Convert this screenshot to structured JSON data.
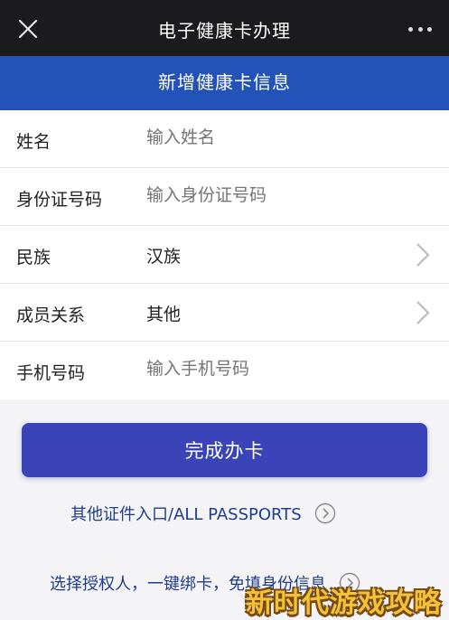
{
  "titlebar": {
    "title": "电子健康卡办理"
  },
  "banner": {
    "text": "新增健康卡信息"
  },
  "form": {
    "rows": [
      {
        "label": "姓名",
        "placeholder": "输入姓名"
      },
      {
        "label": "身份证号码",
        "placeholder": "输入身份证号码"
      },
      {
        "label": "民族",
        "value": "汉族"
      },
      {
        "label": "成员关系",
        "value": "其他"
      },
      {
        "label": "手机号码",
        "placeholder": "输入手机号码"
      }
    ]
  },
  "actions": {
    "submit_label": "完成办卡",
    "other_passports": "其他证件入口/ALL PASSPORTS",
    "authorized_person": "选择授权人，一键绑卡，免填身份信息"
  },
  "watermark": {
    "text": "新时代游戏攻略"
  },
  "colors": {
    "titlebar_bg": "#1b1b1d",
    "banner_bg": "#2353b8",
    "button_bg": "#3a43b7",
    "link_color": "#1f3d8f",
    "placeholder_color": "#b6b6b8"
  },
  "icons": {
    "close": "close-icon",
    "more": "more-dots-icon",
    "chevron": "chevron-right-icon",
    "circle_arrow": "circle-arrow-right-icon"
  }
}
